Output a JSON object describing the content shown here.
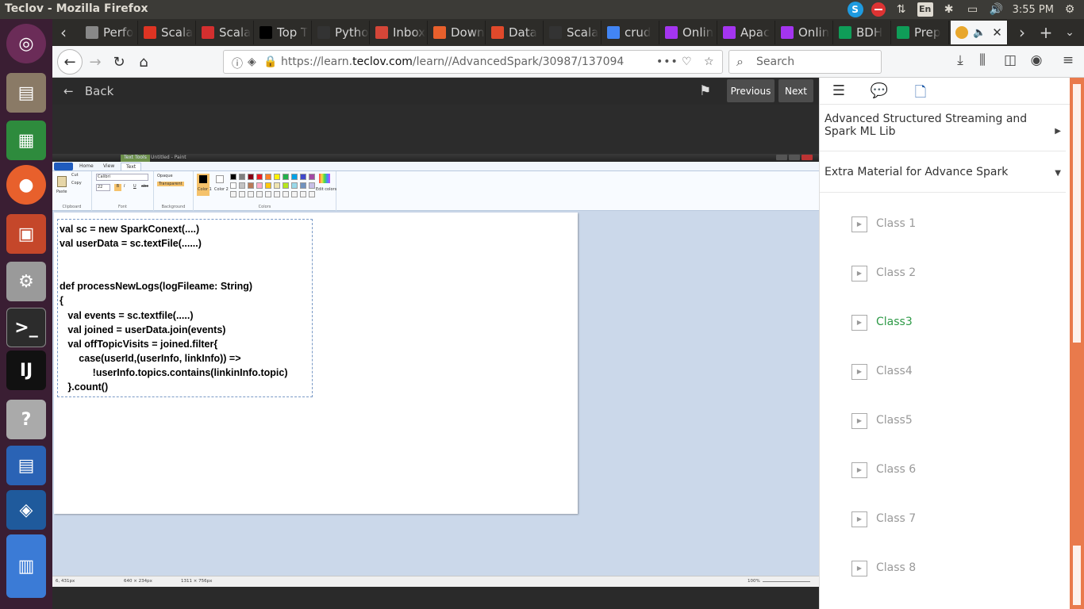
{
  "os": {
    "window_title": "Teclov - Mozilla Firefox",
    "keyboard_layout": "En",
    "clock": "3:55 PM"
  },
  "tabs": [
    {
      "label": "Perfo",
      "icon": "perf-icon",
      "color": "#888888"
    },
    {
      "label": "Scala",
      "icon": "scala-icon",
      "color": "#de3423"
    },
    {
      "label": "Scala",
      "icon": "vivaldi-icon",
      "color": "#d32f2f"
    },
    {
      "label": "Top T",
      "icon": "medium-icon",
      "color": "#000000"
    },
    {
      "label": "Pytho",
      "icon": "github-icon",
      "color": "#333333"
    },
    {
      "label": "Inbox",
      "icon": "gmail-icon",
      "color": "#d44638"
    },
    {
      "label": "Down",
      "icon": "c-icon",
      "color": "#e8602c"
    },
    {
      "label": "Data",
      "icon": "stack-icon",
      "color": "#e0492b"
    },
    {
      "label": "Scala",
      "icon": "github-icon",
      "color": "#333333"
    },
    {
      "label": "crud",
      "icon": "google-icon",
      "color": "#4285f4"
    },
    {
      "label": "Onlin",
      "icon": "udemy-icon",
      "color": "#a435f0"
    },
    {
      "label": "Apac",
      "icon": "udemy-icon",
      "color": "#a435f0"
    },
    {
      "label": "Onlin",
      "icon": "udemy-icon",
      "color": "#a435f0"
    },
    {
      "label": "BDH",
      "icon": "drive-icon",
      "color": "#0f9d58"
    },
    {
      "label": "Prep",
      "icon": "sheets-icon",
      "color": "#0f9d58"
    }
  ],
  "navbar": {
    "url_prefix": "https://learn.",
    "url_domain": "teclov.com",
    "url_path": "/learn//AdvancedSpark/30987/137094",
    "search_placeholder": "Search"
  },
  "page_header": {
    "back_label": "Back",
    "previous_label": "Previous",
    "next_label": "Next"
  },
  "paint": {
    "title_tools": "Text Tools",
    "title_name": "Untitled - Paint",
    "tabs": [
      "Home",
      "View",
      "Text"
    ],
    "clipboard": {
      "paste": "Paste",
      "cut": "Cut",
      "copy": "Copy",
      "label": "Clipboard"
    },
    "font": {
      "family": "Calibri",
      "size": "22",
      "label": "Font"
    },
    "background": {
      "opaque": "Opaque",
      "transparent": "Transparent",
      "label": "Background"
    },
    "colors": {
      "color1": "Color 1",
      "color2": "Color 2",
      "edit": "Edit colors",
      "label": "Colors"
    },
    "code_lines": [
      "val sc = new SparkConext(....)",
      "val userData = sc.textFile(......)",
      "",
      "",
      "def processNewLogs(logFileame: String)",
      "{",
      "   val events = sc.textfile(.....)",
      "   val joined = userData.join(events)",
      "   val offTopicVisits = joined.filter{",
      "       case(userId,(userInfo, linkInfo)) =>",
      "            !userInfo.topics.contains(linkinInfo.topic)",
      "   }.count()"
    ],
    "status": {
      "cursor": "6, 431px",
      "selection": "640 × 234px",
      "canvas": "1311 × 756px",
      "zoom": "100%"
    }
  },
  "sidebar": {
    "sections": [
      {
        "title": "Advanced Structured Streaming and Spark ML Lib"
      },
      {
        "title": "Extra Material for Advance Spark"
      }
    ],
    "lessons": [
      {
        "title": "Class 1"
      },
      {
        "title": "Class 2"
      },
      {
        "title": "Class3"
      },
      {
        "title": "Class4"
      },
      {
        "title": "Class5"
      },
      {
        "title": "Class 6"
      },
      {
        "title": "Class 7"
      },
      {
        "title": "Class 8"
      }
    ],
    "current_lesson_color": "#2e9a47"
  },
  "colors": {
    "launcher_bg": "#3a1e33",
    "accent_scrollbar": "#e97a4c"
  }
}
